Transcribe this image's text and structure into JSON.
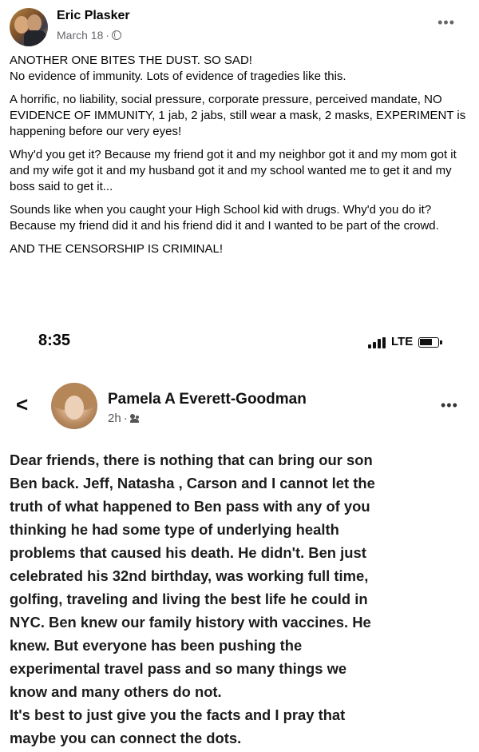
{
  "post": {
    "author": "Eric Plasker",
    "date": "March 18",
    "meta_separator": "·",
    "privacy_icon": "globe-icon",
    "more_label": "•••",
    "paragraphs": [
      "ANOTHER ONE BITES THE DUST. SO SAD!\nNo evidence of immunity. Lots of evidence of tragedies like this.",
      "A horrific, no liability, social pressure, corporate pressure, perceived mandate, NO EVIDENCE OF IMMUNITY, 1 jab, 2 jabs, still wear a mask, 2 masks, EXPERIMENT is happening before our very eyes!",
      "Why'd you get it? Because my friend got it and my neighbor got it and my mom got it and my wife got it and my husband got it and my school wanted me to get it and my boss said to get it...",
      "Sounds like when you caught your High School kid with drugs. Why'd you do it? Because my friend did it and his friend did it and I wanted to be part of the crowd.",
      "AND THE CENSORSHIP IS CRIMINAL!"
    ]
  },
  "embedded": {
    "status_time": "8:35",
    "network": "LTE",
    "signal_bars": [
      0.35,
      0.6,
      0.85,
      1.0
    ],
    "back_label": "<",
    "author": "Pamela A Everett-Goodman",
    "time": "2h",
    "meta_separator": "·",
    "audience_icon": "friends-icon",
    "more_label": "•••",
    "lines": [
      "Dear friends, there is nothing that can bring our son",
      "Ben back. Jeff, Natasha , Carson and I cannot let the",
      "truth of what happened to Ben pass with any of you",
      "thinking he had some type of underlying health",
      "problems that caused his death. He didn't. Ben just",
      "celebrated his 32nd birthday, was working full time,",
      "golfing, traveling and living the best life he could in",
      "NYC. Ben knew our family history with vaccines. He",
      "knew. But everyone has been pushing the",
      "experimental travel pass and so many things we",
      "know and many others do not.",
      "It's best to just give you the facts and I pray that",
      "maybe you can connect the dots."
    ]
  }
}
